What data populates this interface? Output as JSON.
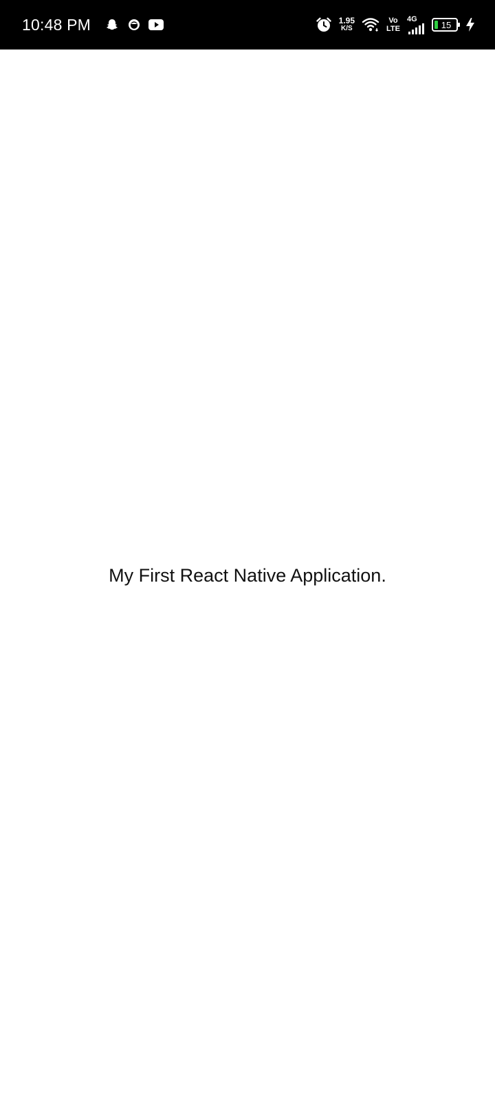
{
  "status_bar": {
    "time": "10:48 PM",
    "left_icons": [
      "snapchat-icon",
      "chat-bubble-icon",
      "youtube-icon"
    ],
    "net_speed_value": "1.95",
    "net_speed_unit": "K/S",
    "volte_top": "Vo",
    "volte_bottom": "LTE",
    "network_type": "4G",
    "battery_level": "15",
    "battery_charging": true,
    "battery_color": "#2ecc40",
    "background": "#000000"
  },
  "app": {
    "message": "My First React Native Application.",
    "background": "#ffffff"
  }
}
